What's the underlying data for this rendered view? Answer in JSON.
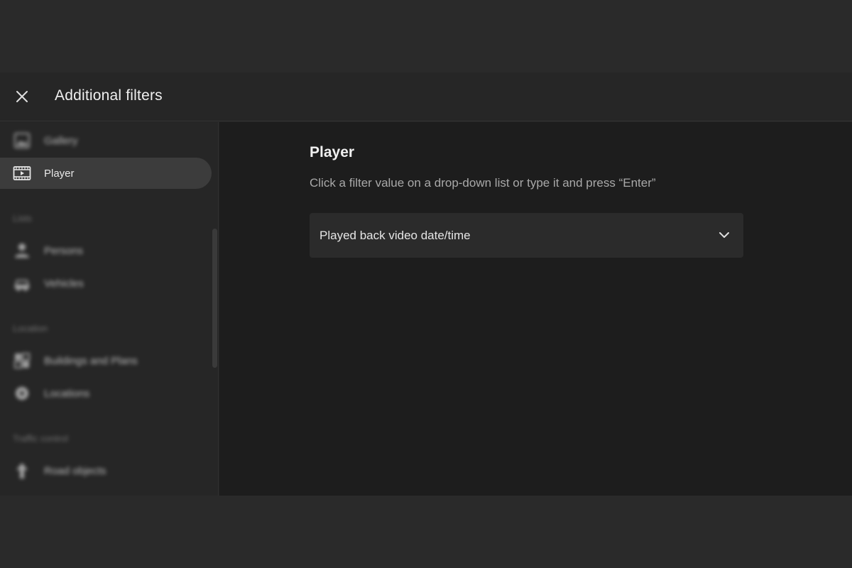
{
  "header": {
    "title": "Additional filters",
    "close_icon": "close-icon"
  },
  "sidebar": {
    "items": [
      {
        "label": "Gallery",
        "icon": "gallery-icon",
        "blurred": true
      },
      {
        "label": "Player",
        "icon": "film-player-icon",
        "active": true
      }
    ],
    "sections": [
      {
        "label": "Lists",
        "items": [
          {
            "label": "Persons",
            "icon": "persons-icon"
          },
          {
            "label": "Vehicles",
            "icon": "vehicles-icon"
          }
        ]
      },
      {
        "label": "Location",
        "items": [
          {
            "label": "Buildings and Plans",
            "icon": "buildings-icon"
          },
          {
            "label": "Locations",
            "icon": "locations-icon"
          }
        ]
      },
      {
        "label": "Traffic control",
        "items": [
          {
            "label": "Road objects",
            "icon": "road-objects-icon"
          }
        ]
      }
    ]
  },
  "main": {
    "title": "Player",
    "hint": "Click a filter value on a drop-down list or type it and press “Enter”",
    "dropdown": {
      "value": "Played back video date/time",
      "icon": "chevron-down-icon"
    }
  },
  "colors": {
    "background": "#2a2a2a",
    "panel": "#1d1d1d",
    "sidebar": "#262626",
    "active_item": "#3c3c3c",
    "field": "#2b2b2b"
  }
}
